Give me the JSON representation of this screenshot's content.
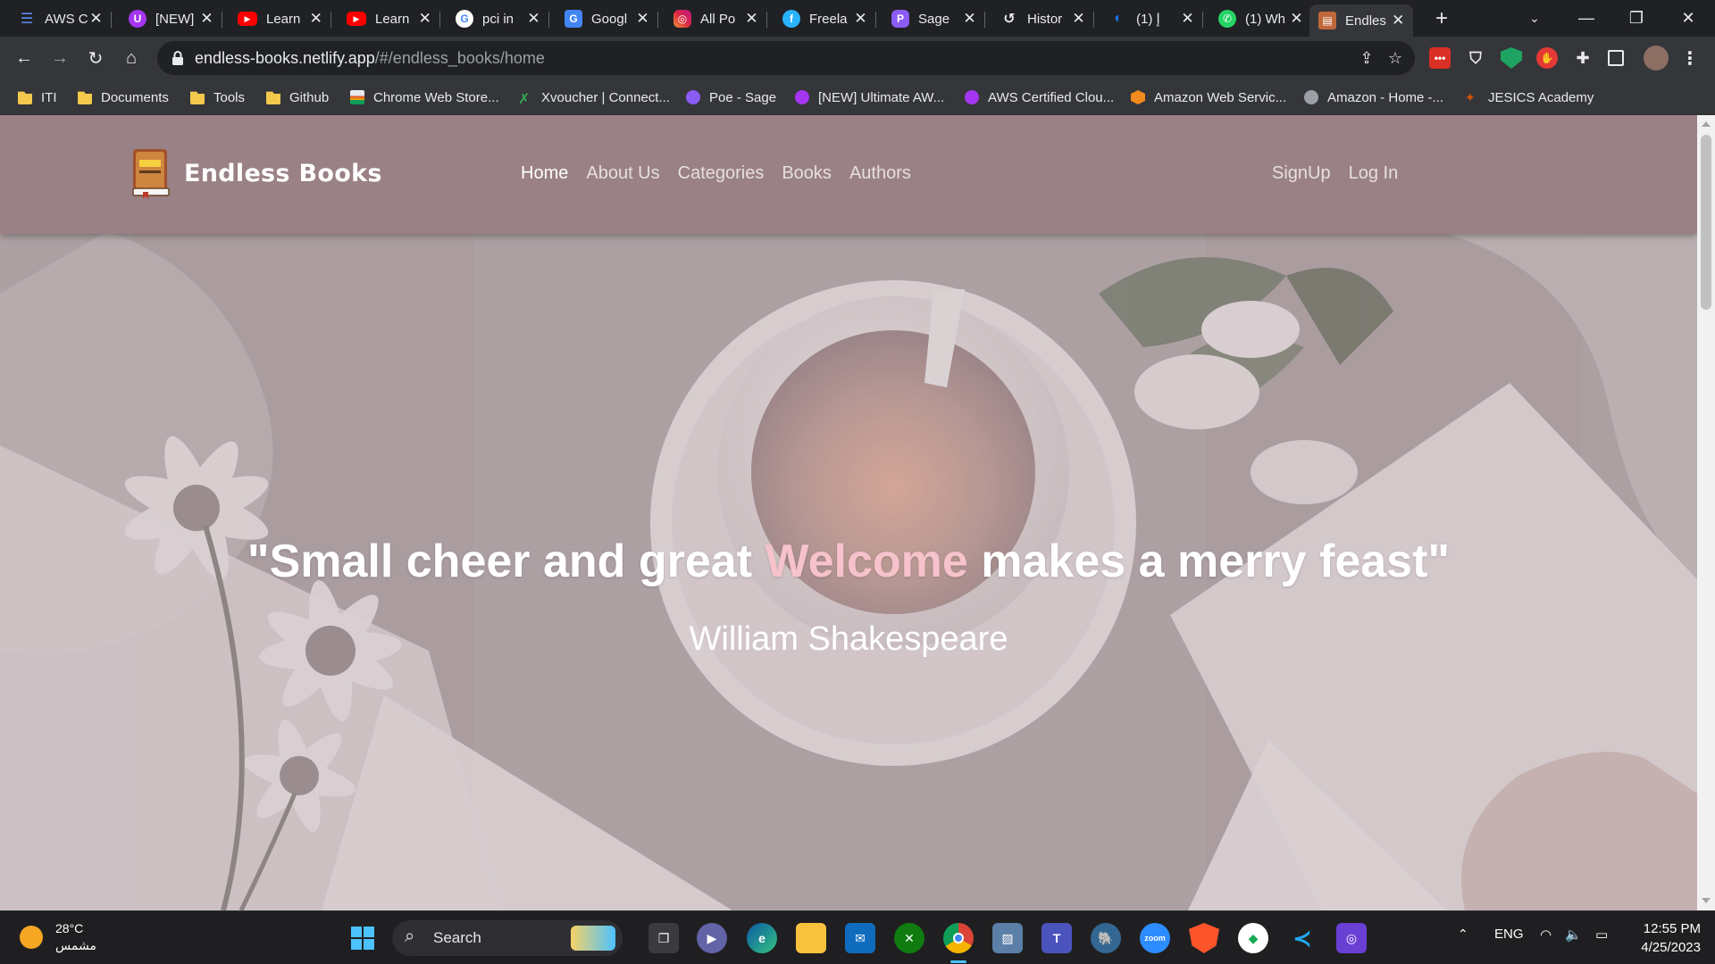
{
  "browser": {
    "tabs": [
      {
        "title": "AWS C",
        "icon": "aws-icon",
        "color": "#5b8def"
      },
      {
        "title": "[NEW]",
        "icon": "udemy-icon",
        "color": "#a435f0"
      },
      {
        "title": "Learn",
        "icon": "youtube-icon",
        "color": "#ff0000"
      },
      {
        "title": "Learn",
        "icon": "youtube-icon",
        "color": "#ff0000"
      },
      {
        "title": "pci in",
        "icon": "google-icon",
        "color": "#ffffff"
      },
      {
        "title": "Googl",
        "icon": "google-translate-icon",
        "color": "#4285f4"
      },
      {
        "title": "All Po",
        "icon": "instagram-icon",
        "color": "#e1306c"
      },
      {
        "title": "Freela",
        "icon": "freelancer-icon",
        "color": "#29b2fe"
      },
      {
        "title": "Sage",
        "icon": "poe-icon",
        "color": "#8b5cf6"
      },
      {
        "title": "Histor",
        "icon": "history-icon",
        "color": "#9aa0a6"
      },
      {
        "title": "إ (1)",
        "icon": "app-icon",
        "color": "#1a73e8"
      },
      {
        "title": "(1) Wh",
        "icon": "whatsapp-icon",
        "color": "#25d366"
      },
      {
        "title": "Endles",
        "icon": "book-icon",
        "color": "#c0683a"
      }
    ],
    "address": {
      "host": "endless-books.netlify.app",
      "path": "/#/endless_books/home"
    },
    "bookmarks": [
      {
        "label": "ITI",
        "icon": "folder-icon"
      },
      {
        "label": "Documents",
        "icon": "folder-icon"
      },
      {
        "label": "Tools",
        "icon": "folder-icon"
      },
      {
        "label": "Github",
        "icon": "folder-icon"
      },
      {
        "label": "Chrome Web Store...",
        "icon": "chrome-web-store-icon"
      },
      {
        "label": "Xvoucher | Connect...",
        "icon": "xvoucher-icon"
      },
      {
        "label": "Poe - Sage",
        "icon": "poe-icon"
      },
      {
        "label": "[NEW] Ultimate AW...",
        "icon": "udemy-icon"
      },
      {
        "label": "AWS Certified Clou...",
        "icon": "udemy-icon"
      },
      {
        "label": "Amazon Web Servic...",
        "icon": "aws-icon"
      },
      {
        "label": "Amazon - Home -...",
        "icon": "globe-icon"
      },
      {
        "label": "JESICS Academy",
        "icon": "jesics-icon"
      }
    ]
  },
  "site": {
    "brand": "Endless Books",
    "nav": [
      "Home",
      "About Us",
      "Categories",
      "Books",
      "Authors"
    ],
    "auth": [
      "SignUp",
      "Log In"
    ],
    "quote": {
      "before": "\"Small cheer and great ",
      "highlight": "Welcome",
      "after": " makes a merry feast\""
    },
    "author": "William Shakespeare",
    "colors": {
      "navbar": "#9a8185",
      "highlight": "#f6c2cb"
    }
  },
  "taskbar": {
    "weather": {
      "temp": "28°C",
      "condition": "مشمس"
    },
    "search_label": "Search",
    "language": "ENG",
    "time": "12:55 PM",
    "date": "4/25/2023"
  }
}
